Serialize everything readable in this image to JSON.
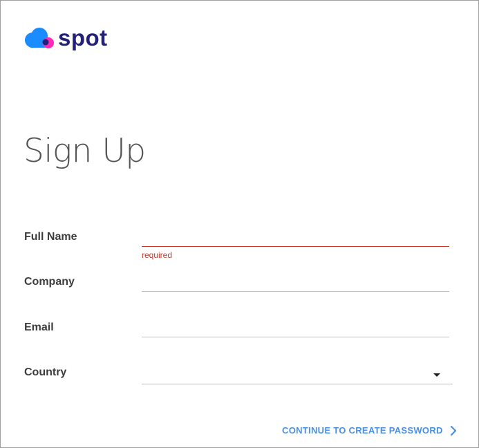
{
  "brand": {
    "name": "spot",
    "colors": {
      "cloud": "#1a8cff",
      "dot": "#ff2ab8",
      "overlap": "#23207a",
      "wordmark": "#23207a"
    },
    "icon": "cloud-logo-icon"
  },
  "page": {
    "title": "Sign Up"
  },
  "form": {
    "full_name": {
      "label": "Full Name",
      "value": "",
      "error": "required"
    },
    "company": {
      "label": "Company",
      "value": ""
    },
    "email": {
      "label": "Email",
      "value": ""
    },
    "country": {
      "label": "Country",
      "selected": "",
      "icon": "caret-down-icon"
    }
  },
  "actions": {
    "continue_label": "CONTINUE TO CREATE PASSWORD",
    "continue_icon": "chevron-right-icon",
    "accent": "#4a90e2"
  },
  "colors": {
    "error": "#c0392b",
    "label": "#3d3d3d",
    "title": "#545454",
    "underline": "#bdbdbd"
  }
}
